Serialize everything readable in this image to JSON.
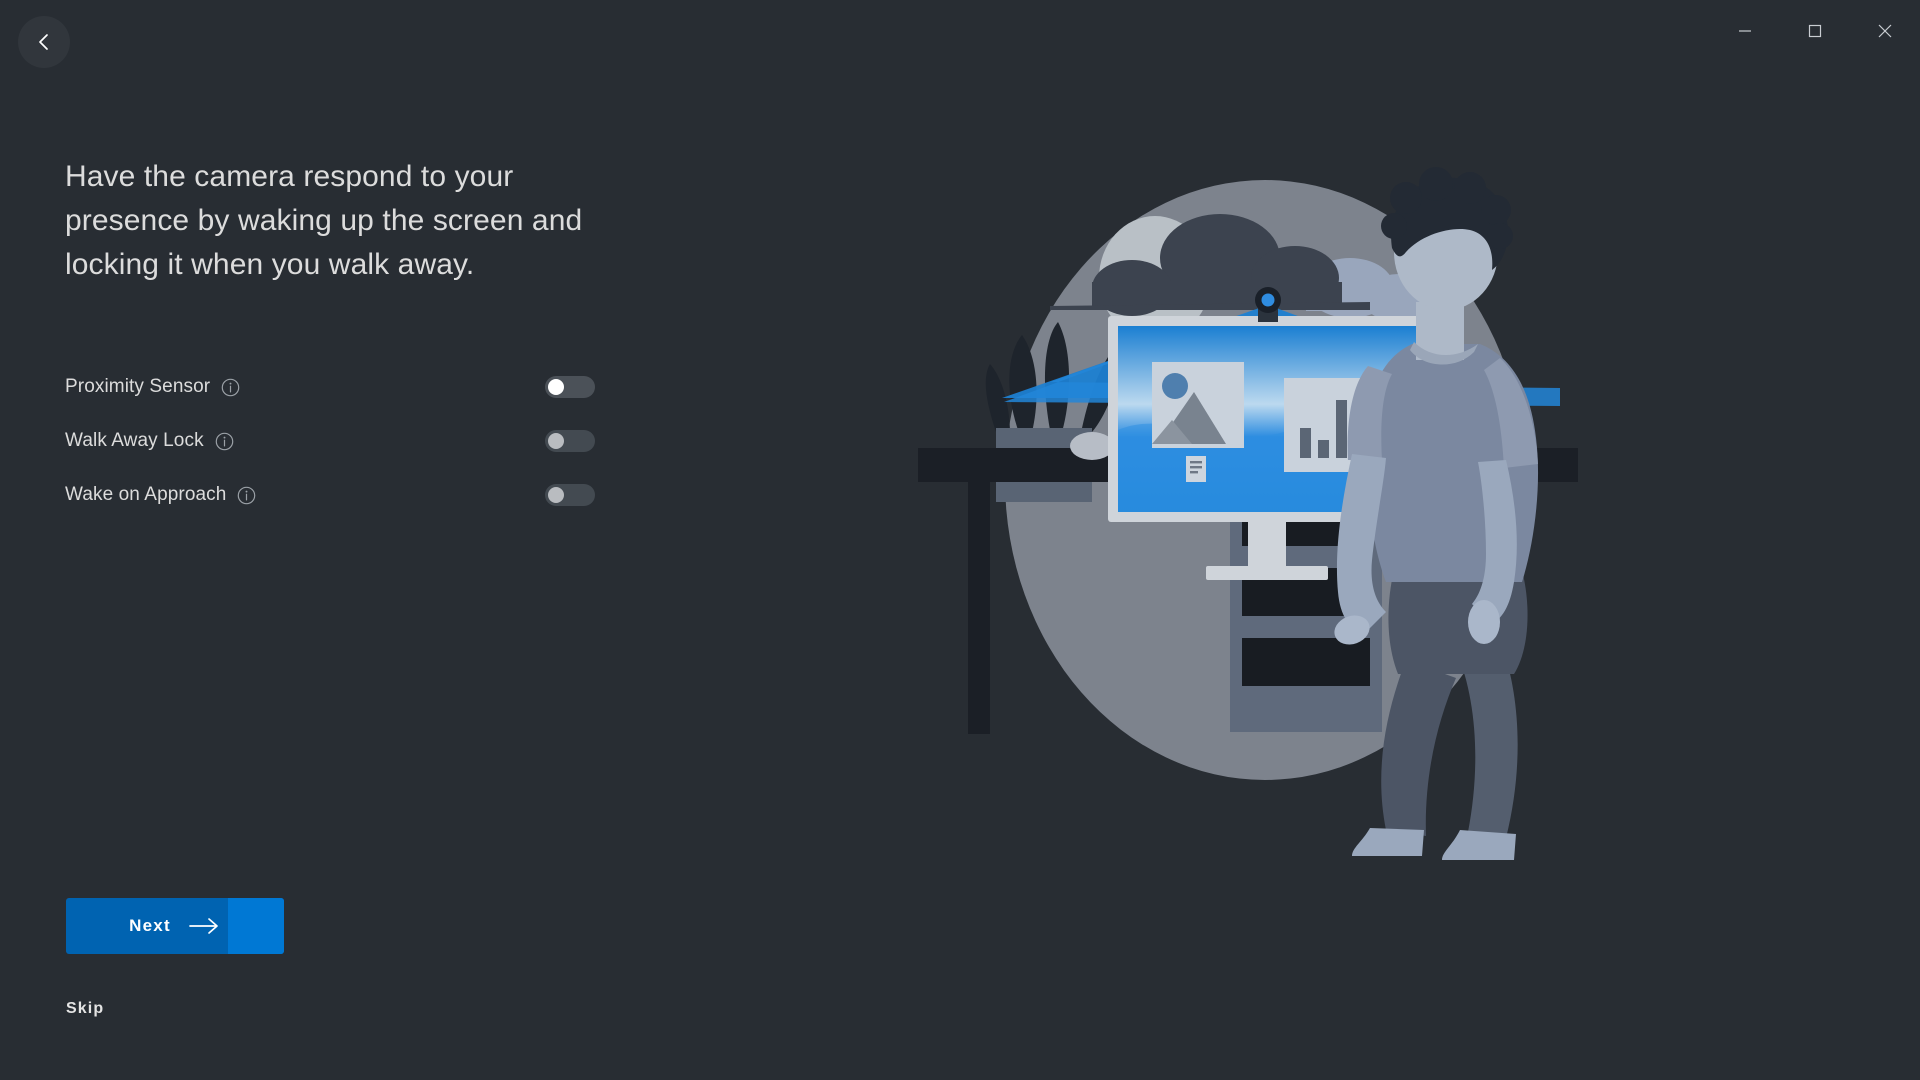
{
  "window": {
    "titlebar": {
      "back_button": "back-chevron",
      "minimize_label": "–",
      "maximize_label": "□",
      "close_label": "✕"
    }
  },
  "main": {
    "headline": "Have the camera respond to your presence by waking up the screen and locking it when you walk away.",
    "settings": [
      {
        "label": "Proximity Sensor",
        "info": "i",
        "enabled": false,
        "highlighted": true
      },
      {
        "label": "Walk Away Lock",
        "info": "i",
        "enabled": false,
        "highlighted": false
      },
      {
        "label": "Wake on Approach",
        "info": "i",
        "enabled": false,
        "highlighted": false
      }
    ],
    "actions": {
      "next_label": "Next",
      "next_arrow": "arrow-right",
      "skip_label": "Skip"
    }
  },
  "illustration": {
    "alt": "Person walking away from a desk with a monitor and webcam detecting presence",
    "elements": [
      "backdrop-circle",
      "moon",
      "clouds",
      "plant",
      "desk",
      "drawer-unit",
      "monitor",
      "webcam",
      "detection-cone",
      "photo-thumbnail",
      "bar-chart",
      "document-icon",
      "person"
    ]
  },
  "colors": {
    "background": "#282d33",
    "accent_blue": "#0078d4",
    "button_blue": "#0063b1",
    "text_primary": "#dcdcdc",
    "toggle_track": "#434a51",
    "toggle_knob_on_focus": "#ffffff",
    "toggle_knob": "#b9bcc0",
    "illustration_circle": "#7d838d",
    "cone_blue": "#1d7fd1"
  }
}
